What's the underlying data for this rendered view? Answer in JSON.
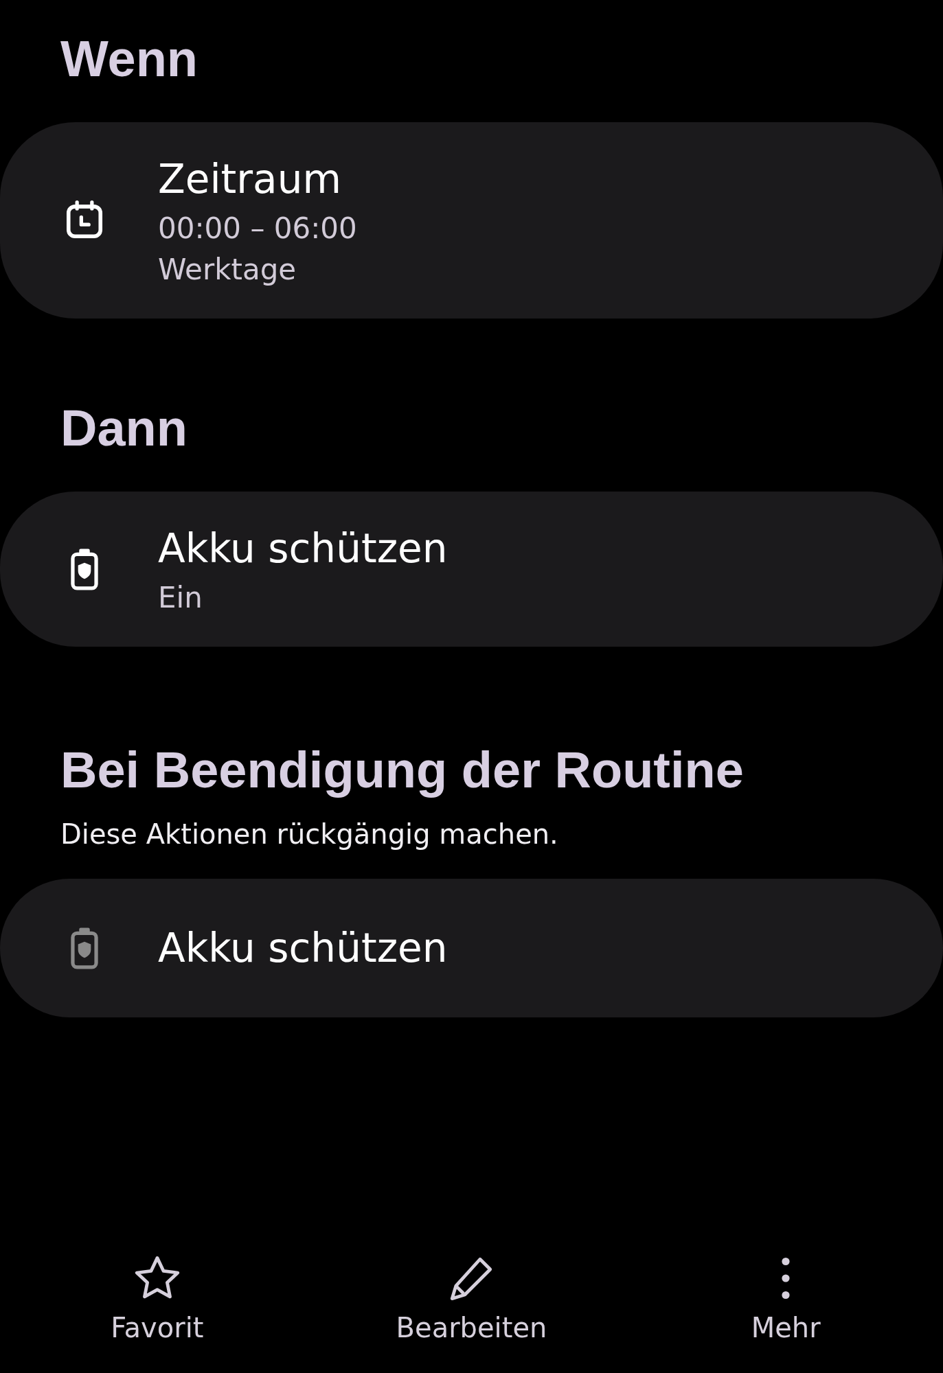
{
  "sections": [
    {
      "heading": "Wenn",
      "cards": [
        {
          "kind": "calendar",
          "icon_dimmed": false,
          "title": "Zeitraum",
          "lines": [
            "00:00 – 06:00",
            "Werktage"
          ]
        }
      ]
    },
    {
      "heading": "Dann",
      "cards": [
        {
          "kind": "battery",
          "icon_dimmed": false,
          "title": "Akku schützen",
          "lines": [
            "Ein"
          ]
        }
      ]
    },
    {
      "heading": "Bei Beendigung der Routine",
      "subtitle": "Diese Aktionen rückgängig machen.",
      "cards": [
        {
          "kind": "battery",
          "icon_dimmed": true,
          "title": "Akku schützen"
        }
      ]
    }
  ],
  "bottom_bar": [
    {
      "kind": "star",
      "label": "Favorit"
    },
    {
      "kind": "pencil",
      "label": "Bearbeiten"
    },
    {
      "kind": "more",
      "label": "Mehr"
    }
  ]
}
